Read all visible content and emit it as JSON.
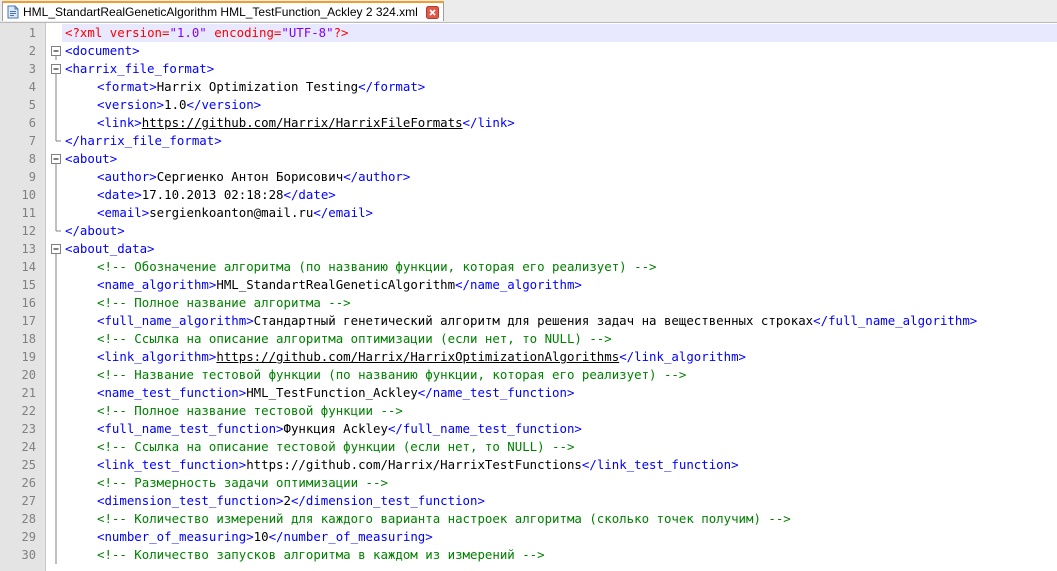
{
  "tab": {
    "title": "HML_StandartRealGeneticAlgorithm HML_TestFunction_Ackley 2 324.xml",
    "icon": "xml-file-icon"
  },
  "lines": [
    {
      "n": "1",
      "fold": "none",
      "indent": 0,
      "current": true,
      "tokens": [
        {
          "t": "decl",
          "v": "<?xml "
        },
        {
          "t": "attr",
          "v": "version="
        },
        {
          "t": "val",
          "v": "\"1.0\""
        },
        {
          "t": "attr",
          "v": " encoding="
        },
        {
          "t": "val",
          "v": "\"UTF-8\""
        },
        {
          "t": "decl",
          "v": "?>"
        }
      ]
    },
    {
      "n": "2",
      "fold": "open",
      "indent": 0,
      "tokens": [
        {
          "t": "tag",
          "v": "<document>"
        }
      ]
    },
    {
      "n": "3",
      "fold": "open",
      "indent": 0,
      "tokens": [
        {
          "t": "tag",
          "v": "<harrix_file_format>"
        }
      ]
    },
    {
      "n": "4",
      "fold": "line",
      "indent": 1,
      "tokens": [
        {
          "t": "tag",
          "v": "<format>"
        },
        {
          "t": "text",
          "v": "Harrix Optimization Testing"
        },
        {
          "t": "tag",
          "v": "</format>"
        }
      ]
    },
    {
      "n": "5",
      "fold": "line",
      "indent": 1,
      "tokens": [
        {
          "t": "tag",
          "v": "<version>"
        },
        {
          "t": "text",
          "v": "1.0"
        },
        {
          "t": "tag",
          "v": "</version>"
        }
      ]
    },
    {
      "n": "6",
      "fold": "line",
      "indent": 1,
      "tokens": [
        {
          "t": "tag",
          "v": "<link>"
        },
        {
          "t": "link",
          "v": "https://github.com/Harrix/HarrixFileFormats"
        },
        {
          "t": "tag",
          "v": "</link>"
        }
      ]
    },
    {
      "n": "7",
      "fold": "end",
      "indent": 0,
      "tokens": [
        {
          "t": "tag",
          "v": "</harrix_file_format>"
        }
      ]
    },
    {
      "n": "8",
      "fold": "open",
      "indent": 0,
      "tokens": [
        {
          "t": "tag",
          "v": "<about>"
        }
      ]
    },
    {
      "n": "9",
      "fold": "line",
      "indent": 1,
      "tokens": [
        {
          "t": "tag",
          "v": "<author>"
        },
        {
          "t": "text",
          "v": "Сергиенко Антон Борисович"
        },
        {
          "t": "tag",
          "v": "</author>"
        }
      ]
    },
    {
      "n": "10",
      "fold": "line",
      "indent": 1,
      "tokens": [
        {
          "t": "tag",
          "v": "<date>"
        },
        {
          "t": "text",
          "v": "17.10.2013 02:18:28"
        },
        {
          "t": "tag",
          "v": "</date>"
        }
      ]
    },
    {
      "n": "11",
      "fold": "line",
      "indent": 1,
      "tokens": [
        {
          "t": "tag",
          "v": "<email>"
        },
        {
          "t": "text",
          "v": "sergienkoanton@mail.ru"
        },
        {
          "t": "tag",
          "v": "</email>"
        }
      ]
    },
    {
      "n": "12",
      "fold": "end",
      "indent": 0,
      "tokens": [
        {
          "t": "tag",
          "v": "</about>"
        }
      ]
    },
    {
      "n": "13",
      "fold": "open",
      "indent": 0,
      "tokens": [
        {
          "t": "tag",
          "v": "<about_data>"
        }
      ]
    },
    {
      "n": "14",
      "fold": "line",
      "indent": 1,
      "tokens": [
        {
          "t": "comment",
          "v": "<!-- Обозначение алгоритма (по названию функции, которая его реализует) -->"
        }
      ]
    },
    {
      "n": "15",
      "fold": "line",
      "indent": 1,
      "tokens": [
        {
          "t": "tag",
          "v": "<name_algorithm>"
        },
        {
          "t": "text",
          "v": "HML_StandartRealGeneticAlgorithm"
        },
        {
          "t": "tag",
          "v": "</name_algorithm>"
        }
      ]
    },
    {
      "n": "16",
      "fold": "line",
      "indent": 1,
      "tokens": [
        {
          "t": "comment",
          "v": "<!-- Полное название алгоритма -->"
        }
      ]
    },
    {
      "n": "17",
      "fold": "line",
      "indent": 1,
      "tokens": [
        {
          "t": "tag",
          "v": "<full_name_algorithm>"
        },
        {
          "t": "text",
          "v": "Стандартный генетический алгоритм для решения задач на вещественных строках"
        },
        {
          "t": "tag",
          "v": "</full_name_algorithm>"
        }
      ]
    },
    {
      "n": "18",
      "fold": "line",
      "indent": 1,
      "tokens": [
        {
          "t": "comment",
          "v": "<!-- Ссылка на описание алгоритма оптимизации (если нет, то NULL) -->"
        }
      ]
    },
    {
      "n": "19",
      "fold": "line",
      "indent": 1,
      "tokens": [
        {
          "t": "tag",
          "v": "<link_algorithm>"
        },
        {
          "t": "link",
          "v": "https://github.com/Harrix/HarrixOptimizationAlgorithms"
        },
        {
          "t": "tag",
          "v": "</link_algorithm>"
        }
      ]
    },
    {
      "n": "20",
      "fold": "line",
      "indent": 1,
      "tokens": [
        {
          "t": "comment",
          "v": "<!-- Название тестовой функции (по названию функции, которая его реализует) -->"
        }
      ]
    },
    {
      "n": "21",
      "fold": "line",
      "indent": 1,
      "tokens": [
        {
          "t": "tag",
          "v": "<name_test_function>"
        },
        {
          "t": "text",
          "v": "HML_TestFunction_Ackley"
        },
        {
          "t": "tag",
          "v": "</name_test_function>"
        }
      ]
    },
    {
      "n": "22",
      "fold": "line",
      "indent": 1,
      "tokens": [
        {
          "t": "comment",
          "v": "<!-- Полное название тестовой функции -->"
        }
      ]
    },
    {
      "n": "23",
      "fold": "line",
      "indent": 1,
      "tokens": [
        {
          "t": "tag",
          "v": "<full_name_test_function>"
        },
        {
          "t": "text",
          "v": "Функция Ackley"
        },
        {
          "t": "tag",
          "v": "</full_name_test_function>"
        }
      ]
    },
    {
      "n": "24",
      "fold": "line",
      "indent": 1,
      "tokens": [
        {
          "t": "comment",
          "v": "<!-- Ссылка на описание тестовой функции (если нет, то NULL) -->"
        }
      ]
    },
    {
      "n": "25",
      "fold": "line",
      "indent": 1,
      "tokens": [
        {
          "t": "tag",
          "v": "<link_test_function>"
        },
        {
          "t": "text",
          "v": "https://github.com/Harrix/HarrixTestFunctions"
        },
        {
          "t": "tag",
          "v": "</link_test_function>"
        }
      ]
    },
    {
      "n": "26",
      "fold": "line",
      "indent": 1,
      "tokens": [
        {
          "t": "comment",
          "v": "<!-- Размерность задачи оптимизации -->"
        }
      ]
    },
    {
      "n": "27",
      "fold": "line",
      "indent": 1,
      "tokens": [
        {
          "t": "tag",
          "v": "<dimension_test_function>"
        },
        {
          "t": "text",
          "v": "2"
        },
        {
          "t": "tag",
          "v": "</dimension_test_function>"
        }
      ]
    },
    {
      "n": "28",
      "fold": "line",
      "indent": 1,
      "tokens": [
        {
          "t": "comment",
          "v": "<!-- Количество измерений для каждого варианта настроек алгоритма (сколько точек получим) -->"
        }
      ]
    },
    {
      "n": "29",
      "fold": "line",
      "indent": 1,
      "tokens": [
        {
          "t": "tag",
          "v": "<number_of_measuring>"
        },
        {
          "t": "text",
          "v": "10"
        },
        {
          "t": "tag",
          "v": "</number_of_measuring>"
        }
      ]
    },
    {
      "n": "30",
      "fold": "line",
      "indent": 1,
      "tokens": [
        {
          "t": "comment",
          "v": "<!-- Количество запусков алгоритма в каждом из измерений -->"
        }
      ]
    }
  ],
  "colors": {
    "tag": "#0000ff",
    "declaration": "#ff0000",
    "attribute_value": "#8000ff",
    "comment": "#008000",
    "tab_accent": "#f59b2c",
    "current_line": "#e8e8ff"
  }
}
